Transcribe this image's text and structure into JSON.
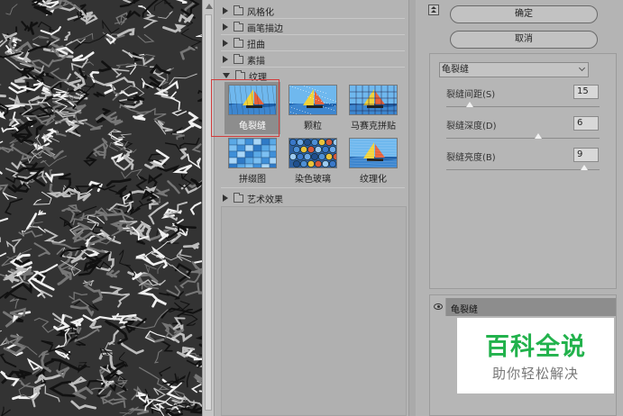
{
  "gallery": {
    "categories": [
      {
        "label": "风格化",
        "expanded": false
      },
      {
        "label": "画笔描边",
        "expanded": false
      },
      {
        "label": "扭曲",
        "expanded": false
      },
      {
        "label": "素描",
        "expanded": false
      },
      {
        "label": "纹理",
        "expanded": true
      },
      {
        "label": "艺术效果",
        "expanded": false
      }
    ],
    "texture_filters": [
      {
        "label": "龟裂缝",
        "selected": true
      },
      {
        "label": "颗粒",
        "selected": false
      },
      {
        "label": "马赛克拼贴",
        "selected": false
      },
      {
        "label": "拼缀图",
        "selected": false
      },
      {
        "label": "染色玻璃",
        "selected": false
      },
      {
        "label": "纹理化",
        "selected": false
      }
    ]
  },
  "buttons": {
    "ok": "确定",
    "cancel": "取消"
  },
  "settings": {
    "filter_select": "龟裂缝",
    "params": [
      {
        "label": "裂缝间距(S)",
        "value": "15",
        "level": 0.15
      },
      {
        "label": "裂缝深度(D)",
        "value": "6",
        "level": 0.6
      },
      {
        "label": "裂缝亮度(B)",
        "value": "9",
        "level": 0.9
      }
    ]
  },
  "layers": {
    "active_layer": "龟裂缝"
  },
  "watermark": {
    "title": "百科全说",
    "subtitle": "助你轻松解决"
  },
  "colors": {
    "selection_border": "#d23c3c",
    "watermark_green": "#22b24c"
  }
}
